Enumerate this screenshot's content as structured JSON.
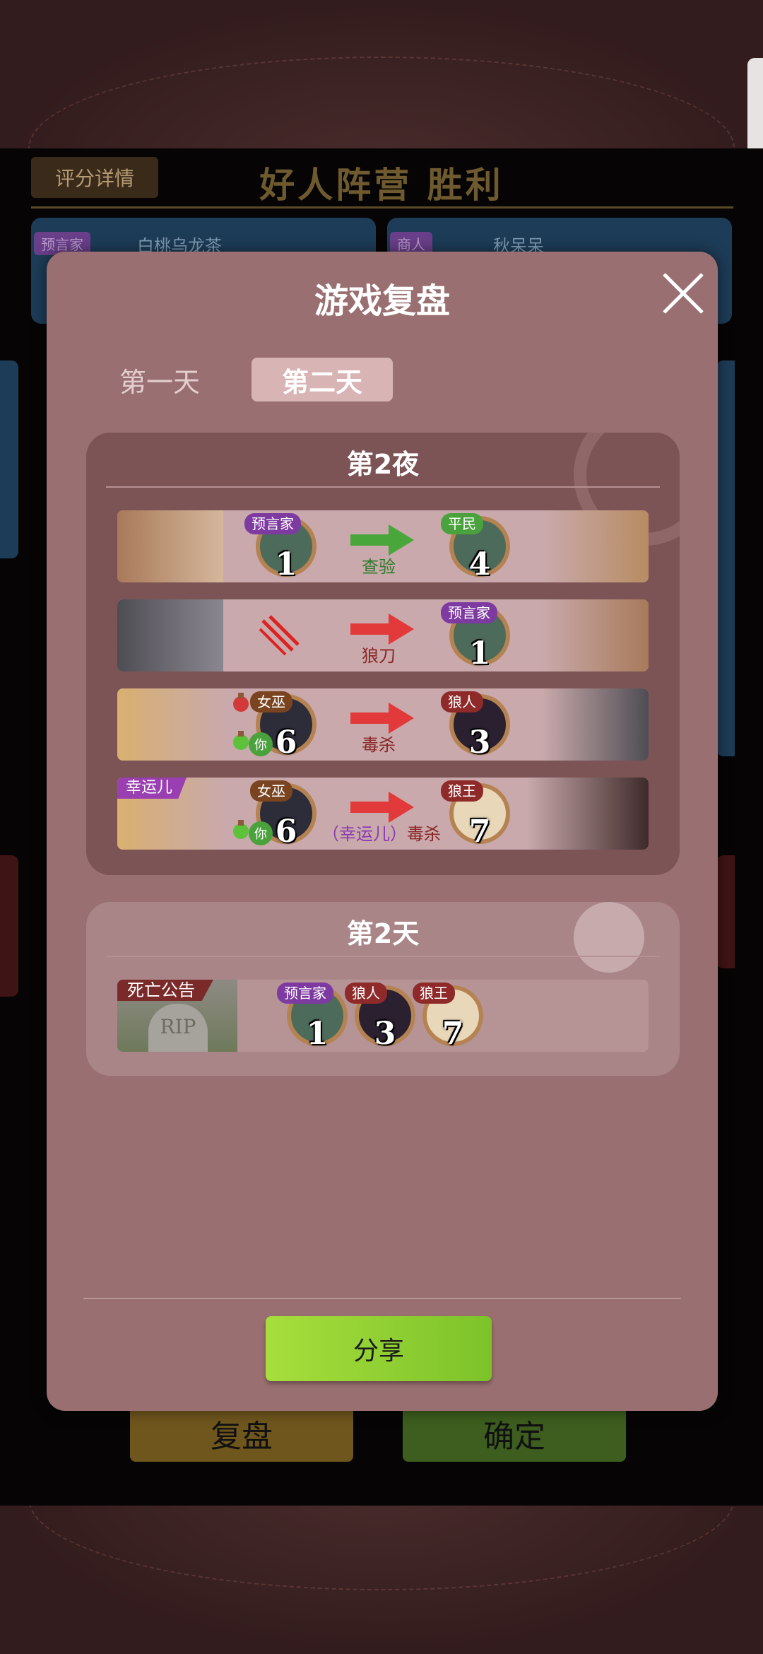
{
  "background": {
    "rating_button": "评分详情",
    "result_title": "好人阵营  胜利",
    "players": [
      {
        "role": "预言家",
        "name": "白桃乌龙茶"
      },
      {
        "role": "商人",
        "name": "秋呆呆"
      }
    ],
    "review_button": "复盘",
    "confirm_button": "确定"
  },
  "modal": {
    "title": "游戏复盘",
    "close_icon": "close-x-icon",
    "tabs": [
      "第一天",
      "第二天"
    ],
    "selected_tab": "第二天",
    "night": {
      "header": "第2夜",
      "events": [
        {
          "actor_role": "预言家",
          "actor_seat": "1",
          "action": "查验",
          "target_role": "平民",
          "target_seat": "4",
          "arrow_color": "#49a63b"
        },
        {
          "actor_role": "",
          "actor_seat": "",
          "action": "狼刀",
          "target_role": "预言家",
          "target_seat": "1",
          "arrow_color": "#e23a3a"
        },
        {
          "actor_role": "女巫",
          "actor_seat": "6",
          "actor_you": "你",
          "action": "毒杀",
          "target_role": "狼人",
          "target_seat": "3",
          "arrow_color": "#e23a3a"
        },
        {
          "lucky_tag": "幸运儿",
          "actor_role": "女巫",
          "actor_seat": "6",
          "actor_you": "你",
          "action_prefix": "（幸运儿）",
          "action": "毒杀",
          "target_role": "狼王",
          "target_seat": "7",
          "arrow_color": "#e23a3a"
        }
      ]
    },
    "day": {
      "header": "第2天",
      "death_label": "死亡公告",
      "tombstone_text": "RIP",
      "dead": [
        {
          "role": "预言家",
          "seat": "1"
        },
        {
          "role": "狼人",
          "seat": "3"
        },
        {
          "role": "狼王",
          "seat": "7"
        }
      ]
    },
    "share_button": "分享"
  }
}
